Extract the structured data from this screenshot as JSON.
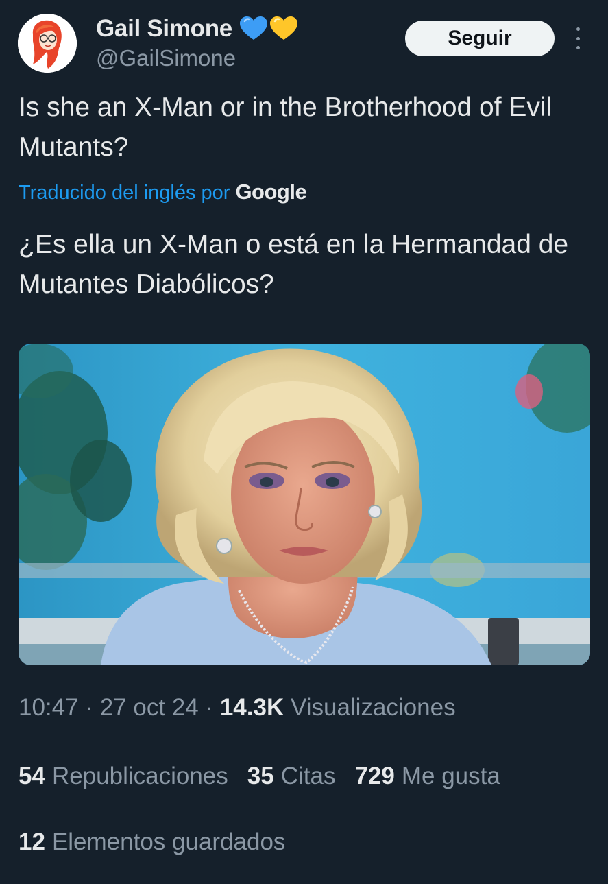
{
  "author": {
    "name": "Gail Simone",
    "handle": "@GailSimone",
    "badges": [
      "blue-heart",
      "yellow-heart"
    ]
  },
  "actions": {
    "follow_label": "Seguir",
    "more_icon": "more-vertical-icon"
  },
  "tweet": {
    "text": "Is she an X-Man or in the Brotherhood of Evil Mutants?",
    "translation_note": "Traducido del inglés por",
    "translation_provider": "Google",
    "translated_text": "¿Es ella un X-Man o está en la Hermandad de Mutantes Diabólicos?"
  },
  "meta": {
    "time": "10:47",
    "sep1": "·",
    "date": "27 oct 24",
    "sep2": "·",
    "views_count": "14.3K",
    "views_label": "Visualizaciones"
  },
  "stats": {
    "reposts_count": "54",
    "reposts_label": "Republicaciones",
    "quotes_count": "35",
    "quotes_label": "Citas",
    "likes_count": "729",
    "likes_label": "Me gusta",
    "bookmarks_count": "12",
    "bookmarks_label": "Elementos guardados"
  },
  "colors": {
    "background": "#15202b",
    "text_primary": "#e7e9ea",
    "text_secondary": "#8b98a5",
    "link": "#1d9bf0",
    "divider": "#38444d"
  }
}
